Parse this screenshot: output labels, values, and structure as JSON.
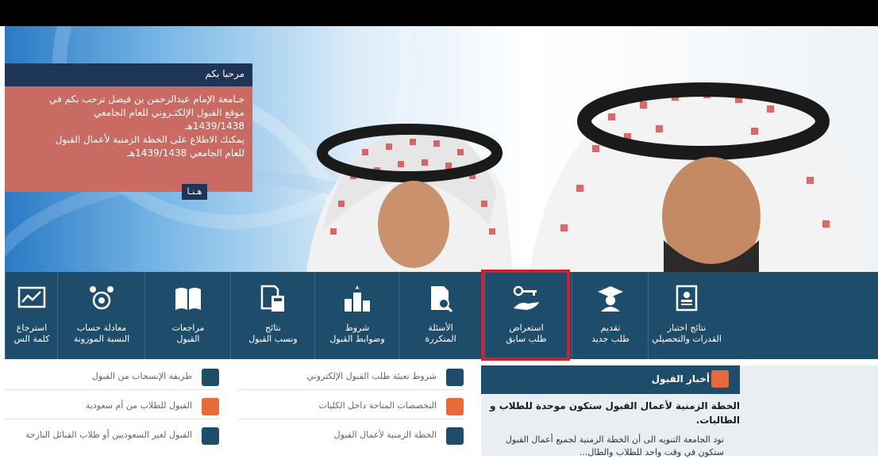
{
  "welcome": {
    "title": "مرحبا بكم",
    "lines": [
      "جـامعة الإمام عبدالرحمن بن فيصل ترحب بكم في",
      "موقع القبول الإلكتـروني للعام الجامعي",
      "1439/1438هـ",
      "يمكنك الاطلاع على الخطة الزمنية لأعمال القبول",
      "للعام الجامعي 1439/1438هـ"
    ],
    "button": "هـنـا"
  },
  "nav": [
    {
      "label1": "نتائج اختبار",
      "label2": "القدرات والتحصيلي",
      "icon": "certificate-icon"
    },
    {
      "label1": "تقديم",
      "label2": "طلب جديد",
      "icon": "graduate-icon"
    },
    {
      "label1": "استعراض",
      "label2": "طلب سابق",
      "icon": "key-hand-icon"
    },
    {
      "label1": "الأسئلة",
      "label2": "المتكررة",
      "icon": "document-search-icon"
    },
    {
      "label1": "شروط",
      "label2": "وضوابط القبول",
      "icon": "ranking-icon"
    },
    {
      "label1": "نتائج",
      "label2": "ونسب القبول",
      "icon": "calculator-doc-icon"
    },
    {
      "label1": "مراجعات",
      "label2": "القبول",
      "icon": "book-icon"
    },
    {
      "label1": "معادلة حساب",
      "label2": "النسبة الموزونة",
      "icon": "people-target-icon"
    },
    {
      "label1": "استرجاع",
      "label2": "كلمة الس",
      "icon": "chart-monitor-icon"
    }
  ],
  "news": {
    "header": "أخبار القبول",
    "title": "الخطة الزمنية لأعمال القبول ستكون موحدة للطلاب و الطالبات.",
    "text": "تود الجامعة التنويه الى أن الخطة الزمنية لجميع أعمال القبول ستكون في وقت واحد للطلاب والطال..."
  },
  "links_mid": [
    {
      "text": "شروط تعبئة طلب القبول الإلكتروني",
      "icon": "document-icon"
    },
    {
      "text": "التخصصات المتاحة داخل الكليات",
      "icon": "exit-doc-icon"
    },
    {
      "text": "الخطة الزمنية لأعمال القبول",
      "icon": "open-book-icon"
    }
  ],
  "links_left": [
    {
      "text": "طريقة الإنسحاب من القبول",
      "icon": "briefcase-icon"
    },
    {
      "text": "القبول للطلاب من أم سعودية",
      "icon": "person-icon"
    },
    {
      "text": "القبول لغير السعوديين أو طلاب القبائل النازحة",
      "icon": "flag-icon"
    }
  ]
}
